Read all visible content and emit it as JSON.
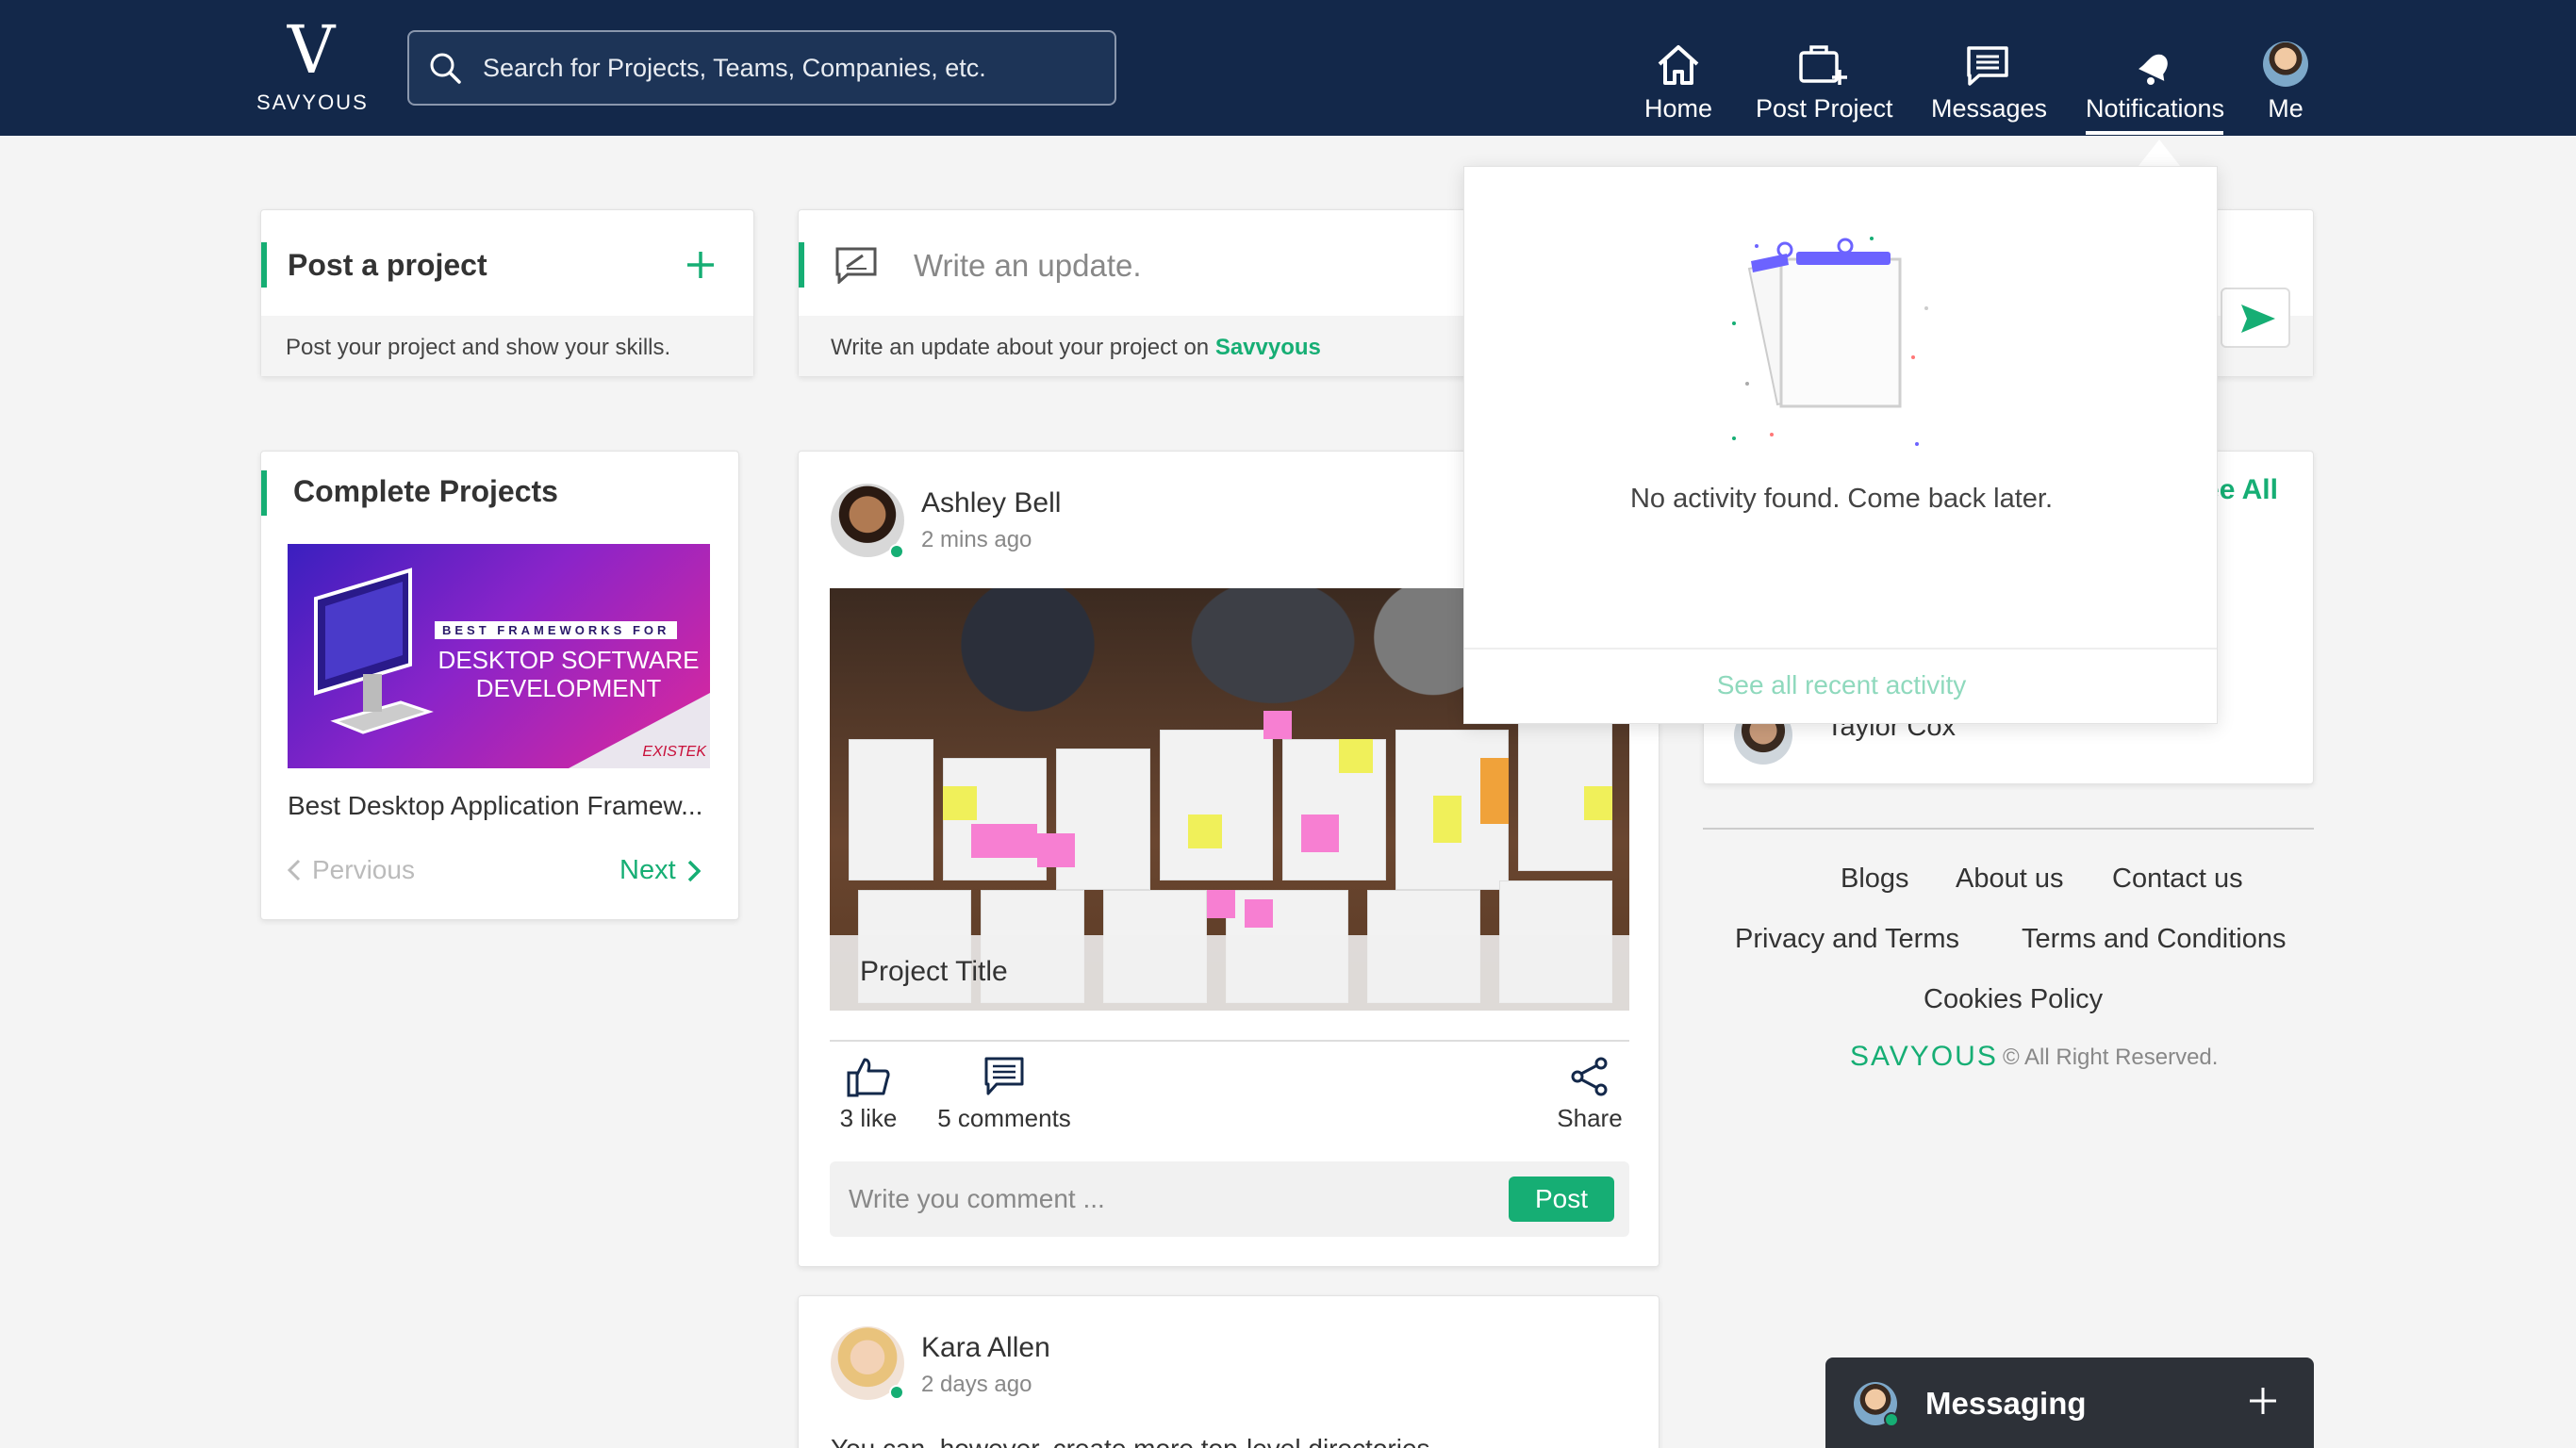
{
  "brand": {
    "logo_letter": "V",
    "logo_word": "SAVYOUS",
    "footer_word": "SAVYOUS"
  },
  "search": {
    "placeholder": "Search for Projects, Teams, Companies, etc."
  },
  "nav": {
    "home": "Home",
    "post_project": "Post Project",
    "messages": "Messages",
    "notifications": "Notifications",
    "me": "Me"
  },
  "post_project_card": {
    "title": "Post a project",
    "subtitle": "Post your project and show your skills."
  },
  "update_card": {
    "placeholder": "Write an update.",
    "subtitle_prefix": "Write an update about your project on ",
    "subtitle_brand": "Savvyous"
  },
  "complete_projects": {
    "title": "Complete Projects",
    "thumb_line1": "BEST FRAMEWORKS FOR",
    "thumb_line2": "DESKTOP SOFTWARE",
    "thumb_line3": "DEVELOPMENT",
    "thumb_brand": "EXISTEK",
    "item_title": "Best Desktop Application Framew...",
    "prev": "Pervious",
    "next": "Next"
  },
  "post1": {
    "author": "Ashley Bell",
    "time": "2 mins ago",
    "image_caption": "Project Title",
    "likes": "3 like",
    "comments": "5 comments",
    "share": "Share",
    "comment_placeholder": "Write you comment ...",
    "post_button": "Post"
  },
  "post2": {
    "author": "Kara Allen",
    "time": "2 days ago",
    "text_peek": "You can, however, create more top-level directories"
  },
  "right_panel": {
    "see_all": "See All",
    "person": "Taylor Cox"
  },
  "notifications_dropdown": {
    "empty_message": "No activity found. Come back later.",
    "see_all_link": "See all recent activity"
  },
  "footer": {
    "links": [
      "Blogs",
      "About us",
      "Contact us",
      "Privacy and Terms",
      "Terms and Conditions",
      "Cookies Policy"
    ],
    "copyright": "© All Right Reserved."
  },
  "messaging": {
    "label": "Messaging"
  },
  "colors": {
    "navy": "#13284a",
    "accent": "#16ae74",
    "bell_accent": "#6c63ff"
  }
}
